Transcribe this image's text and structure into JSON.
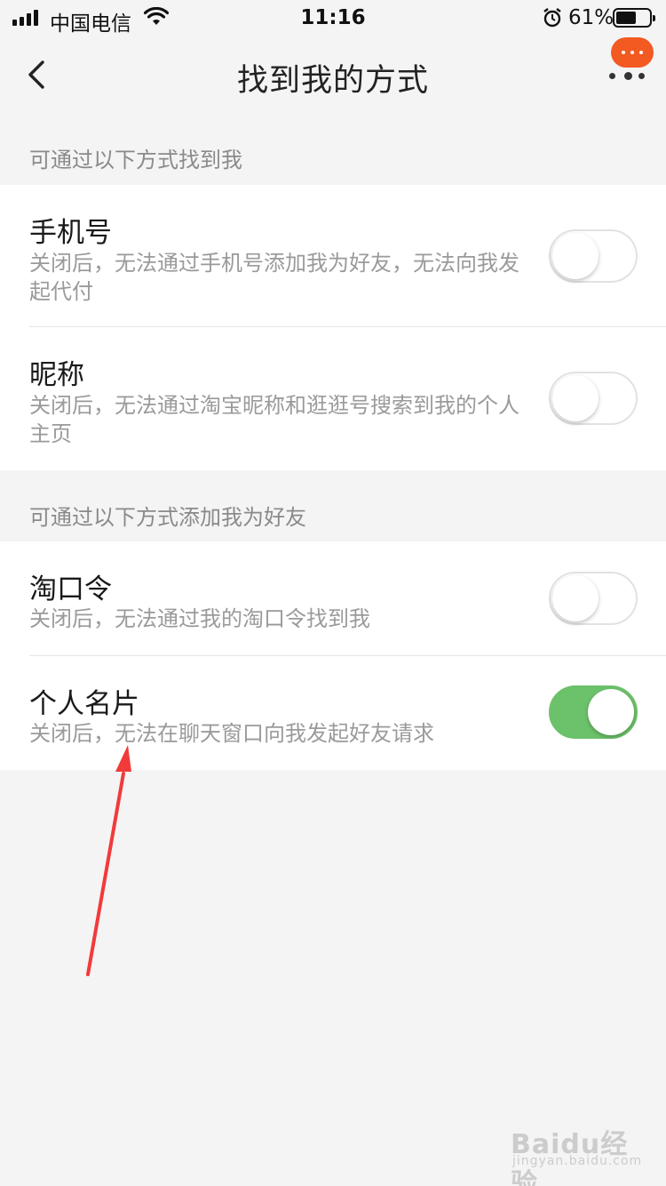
{
  "status_bar": {
    "carrier": "中国电信",
    "time": "11:16",
    "battery_percent": "61%",
    "battery_level": 0.61,
    "icons": [
      "signal-icon",
      "wifi-icon",
      "alarm-icon",
      "battery-icon"
    ]
  },
  "nav": {
    "title": "找到我的方式",
    "back_icon": "chevron-left-icon",
    "more_icon": "more-dots-icon",
    "badge_color": "#f25a22"
  },
  "sections": [
    {
      "header": "可通过以下方式找到我",
      "items": [
        {
          "title": "手机号",
          "description": "关闭后，无法通过手机号添加我为好友，无法向我发起代付",
          "enabled": false
        },
        {
          "title": "昵称",
          "description": "关闭后，无法通过淘宝昵称和逛逛号搜索到我的个人主页",
          "enabled": false
        }
      ]
    },
    {
      "header": "可通过以下方式添加我为好友",
      "items": [
        {
          "title": "淘口令",
          "description": "关闭后，无法通过我的淘口令找到我",
          "enabled": false
        },
        {
          "title": "个人名片",
          "description": "关闭后，无法在聊天窗口向我发起好友请求",
          "enabled": true
        }
      ]
    }
  ],
  "colors": {
    "toggle_on": "#6cc16b",
    "annotation_arrow": "#f23a3a",
    "background": "#f4f4f4"
  },
  "watermark": {
    "main": "Baidu经验",
    "sub": "jingyan.baidu.com"
  }
}
